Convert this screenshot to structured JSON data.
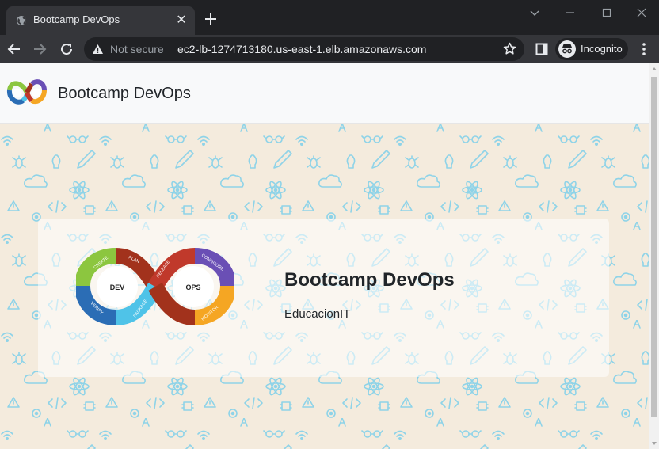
{
  "browser": {
    "tab_title": "Bootcamp DevOps",
    "not_secure_label": "Not secure",
    "url": "ec2-lb-1274713180.us-east-1.elb.amazonaws.com",
    "incognito_label": "Incognito"
  },
  "navbar": {
    "brand": "Bootcamp DevOps"
  },
  "hero": {
    "title": "Bootcamp DevOps",
    "subtitle": "EducacionIT",
    "logo": {
      "left_label": "DEV",
      "right_label": "OPS",
      "segments": [
        "CREATE",
        "PLAN",
        "RELEASE",
        "CONFIGURE",
        "MONITOR",
        "PACKAGE",
        "VERIFY"
      ]
    }
  },
  "colors": {
    "chrome_dark": "#202124",
    "chrome_toolbar": "#35363a",
    "hero_bg": "#f4ebdd",
    "pattern": "#8ed3e8"
  }
}
